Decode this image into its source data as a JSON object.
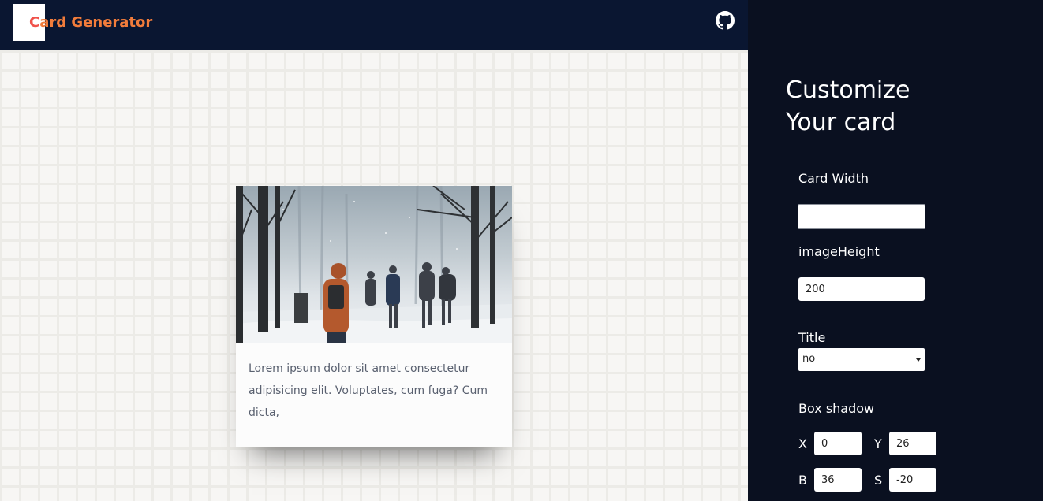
{
  "header": {
    "brand_prefix": "C",
    "brand_rest": "ard Generator",
    "github_icon": "github-icon"
  },
  "card": {
    "text": "Lorem ipsum dolor sit amet consectetur adipisicing elit. Voluptates, cum fuga? Cum dicta,"
  },
  "panel": {
    "title_line1": "Customize",
    "title_line2": "Your card",
    "card_width_label": "Card Width",
    "card_width_value": "",
    "image_height_label": "imageHeight",
    "image_height_value": "200",
    "title_label": "Title",
    "title_selected": "no",
    "box_shadow_label": "Box shadow",
    "shadow": {
      "x_label": "X",
      "x_value": "0",
      "y_label": "Y",
      "y_value": "26",
      "b_label": "B",
      "b_value": "36",
      "s_label": "S",
      "s_value": "-20"
    }
  },
  "colors": {
    "navbar": "#0a1631",
    "panel": "#0a1020",
    "brand": "#f0524b",
    "background": "#f7f6f4"
  }
}
